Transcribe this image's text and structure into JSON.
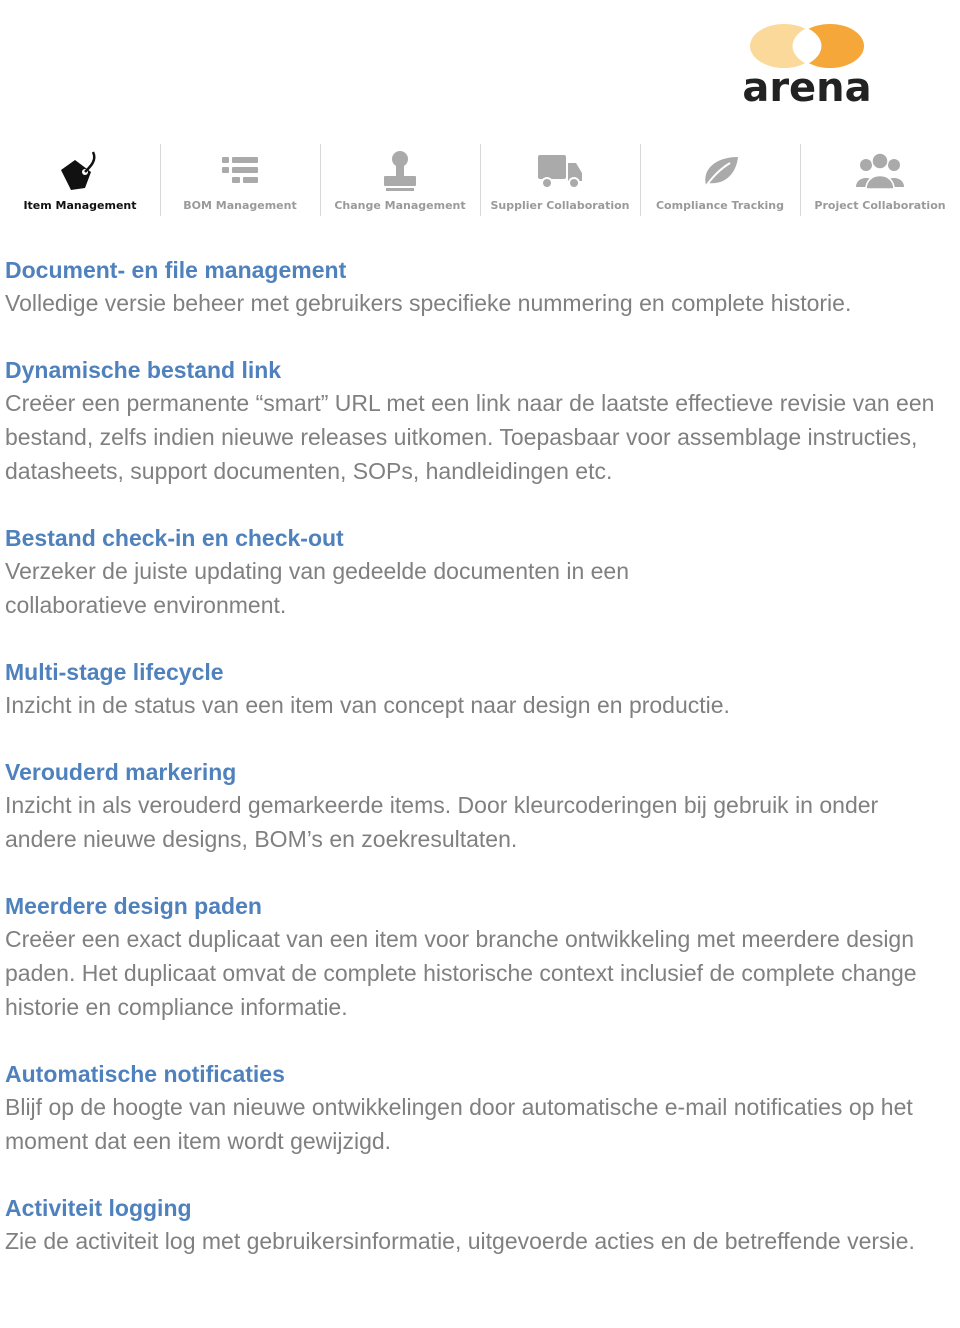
{
  "brand": {
    "name": "arena",
    "colors": {
      "left_circle": "#f9d48c",
      "right_circle": "#f5a623",
      "text": "#222222"
    }
  },
  "nav": {
    "items": [
      {
        "label": "Item Management",
        "icon": "tag-icon",
        "active": true
      },
      {
        "label": "BOM Management",
        "icon": "list-icon",
        "active": false
      },
      {
        "label": "Change Management",
        "icon": "stamp-icon",
        "active": false
      },
      {
        "label": "Supplier Collaboration",
        "icon": "truck-icon",
        "active": false
      },
      {
        "label": "Compliance Tracking",
        "icon": "leaf-icon",
        "active": false
      },
      {
        "label": "Project Collaboration",
        "icon": "users-icon",
        "active": false
      }
    ]
  },
  "sections": [
    {
      "title": "Document- en file management",
      "body": "Volledige versie beheer met gebruikers specifieke nummering en complete historie."
    },
    {
      "title": "Dynamische bestand link",
      "body": "Creëer een permanente “smart” URL met een link naar de laatste effectieve revisie van een bestand, zelfs indien nieuwe releases uitkomen. Toepasbaar voor assemblage instructies, datasheets, support documenten, SOPs, handleidingen etc."
    },
    {
      "title": "Bestand check-in en check-out",
      "body": "Verzeker de juiste updating van gedeelde documenten in een collaboratieve environment."
    },
    {
      "title": "Multi-stage lifecycle",
      "body": "Inzicht in de status van een item van concept naar design en productie."
    },
    {
      "title": "Verouderd markering",
      "body": "Inzicht in als verouderd gemarkeerde items. Door kleurcoderingen bij gebruik in onder andere nieuwe designs, BOM’s en zoekresultaten."
    },
    {
      "title": "Meerdere design paden",
      "body": "Creëer een exact duplicaat van een item voor branche ontwikkeling met meerdere design paden. Het duplicaat omvat de complete historische context inclusief de complete change historie en compliance informatie."
    },
    {
      "title": "Automatische notificaties",
      "body": "Blijf op de hoogte van nieuwe ontwikkelingen door automatische e-mail notificaties op het moment dat een item wordt gewijzigd."
    },
    {
      "title": "Activiteit logging",
      "body": "Zie de activiteit log met gebruikersinformatie, uitgevoerde acties en de betreffende versie."
    }
  ],
  "colors": {
    "heading": "#4f81bd",
    "body": "#808080",
    "nav_inactive": "#9a9a9a",
    "nav_active": "#111111"
  }
}
